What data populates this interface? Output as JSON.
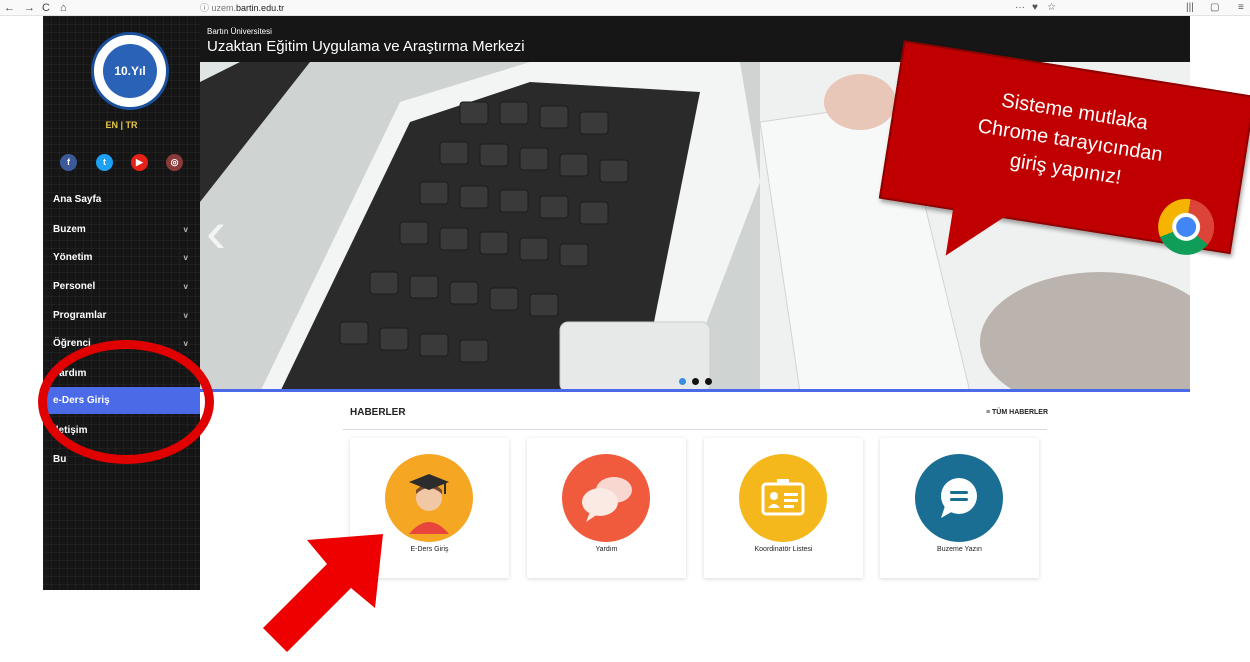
{
  "browser": {
    "back": "←",
    "forward": "→",
    "reload": "C",
    "home": "⌂",
    "info_icon": "ⓘ",
    "url_prefix": "uzem.",
    "url_domain": "bartin.edu.tr",
    "menu_dots": "···",
    "pocket": "♥",
    "star": "☆",
    "library": "|||",
    "sidebar_toggle": "▢",
    "hamburger": "≡"
  },
  "sidebar": {
    "logo_text": "10.Yıl",
    "lang": "EN  |  TR",
    "social": [
      {
        "label": "f",
        "color": "#3b5998"
      },
      {
        "label": "t",
        "color": "#1da1f2"
      },
      {
        "label": "▶",
        "color": "#e62117"
      },
      {
        "label": "◎",
        "color": "#8a3a3a"
      }
    ],
    "items": [
      {
        "label": "Ana Sayfa",
        "chevron": ""
      },
      {
        "label": "Buzem",
        "chevron": "v"
      },
      {
        "label": "Yönetim",
        "chevron": "v"
      },
      {
        "label": "Personel",
        "chevron": "v"
      },
      {
        "label": "Programlar",
        "chevron": "v"
      },
      {
        "label": "Öğrenci",
        "chevron": "v"
      },
      {
        "label": "Yardım",
        "chevron": ""
      },
      {
        "label": "e-Ders Giriş",
        "chevron": ""
      },
      {
        "label": "İletişim",
        "chevron": ""
      },
      {
        "label": "Bu",
        "chevron": ""
      }
    ]
  },
  "header": {
    "subtitle": "Bartın Üniversitesi",
    "title": "Uzaktan Eğitim Uygulama ve Araştırma Merkezi"
  },
  "hero": {
    "prev_arrow": "‹"
  },
  "callout": {
    "line1": "Sisteme mutlaka",
    "line2": "Chrome tarayıcından",
    "line3": "giriş yapınız!"
  },
  "news": {
    "title": "HABERLER",
    "all_link": "≡ TÜM HABERLER",
    "cards": [
      {
        "label": "E-Ders Giriş",
        "color": "#f5a623"
      },
      {
        "label": "Yardım",
        "color": "#ef5b3c"
      },
      {
        "label": "Koordinatör Listesi",
        "color": "#f4b81c"
      },
      {
        "label": "Buzeme Yazın",
        "color": "#1b6e93"
      }
    ]
  }
}
